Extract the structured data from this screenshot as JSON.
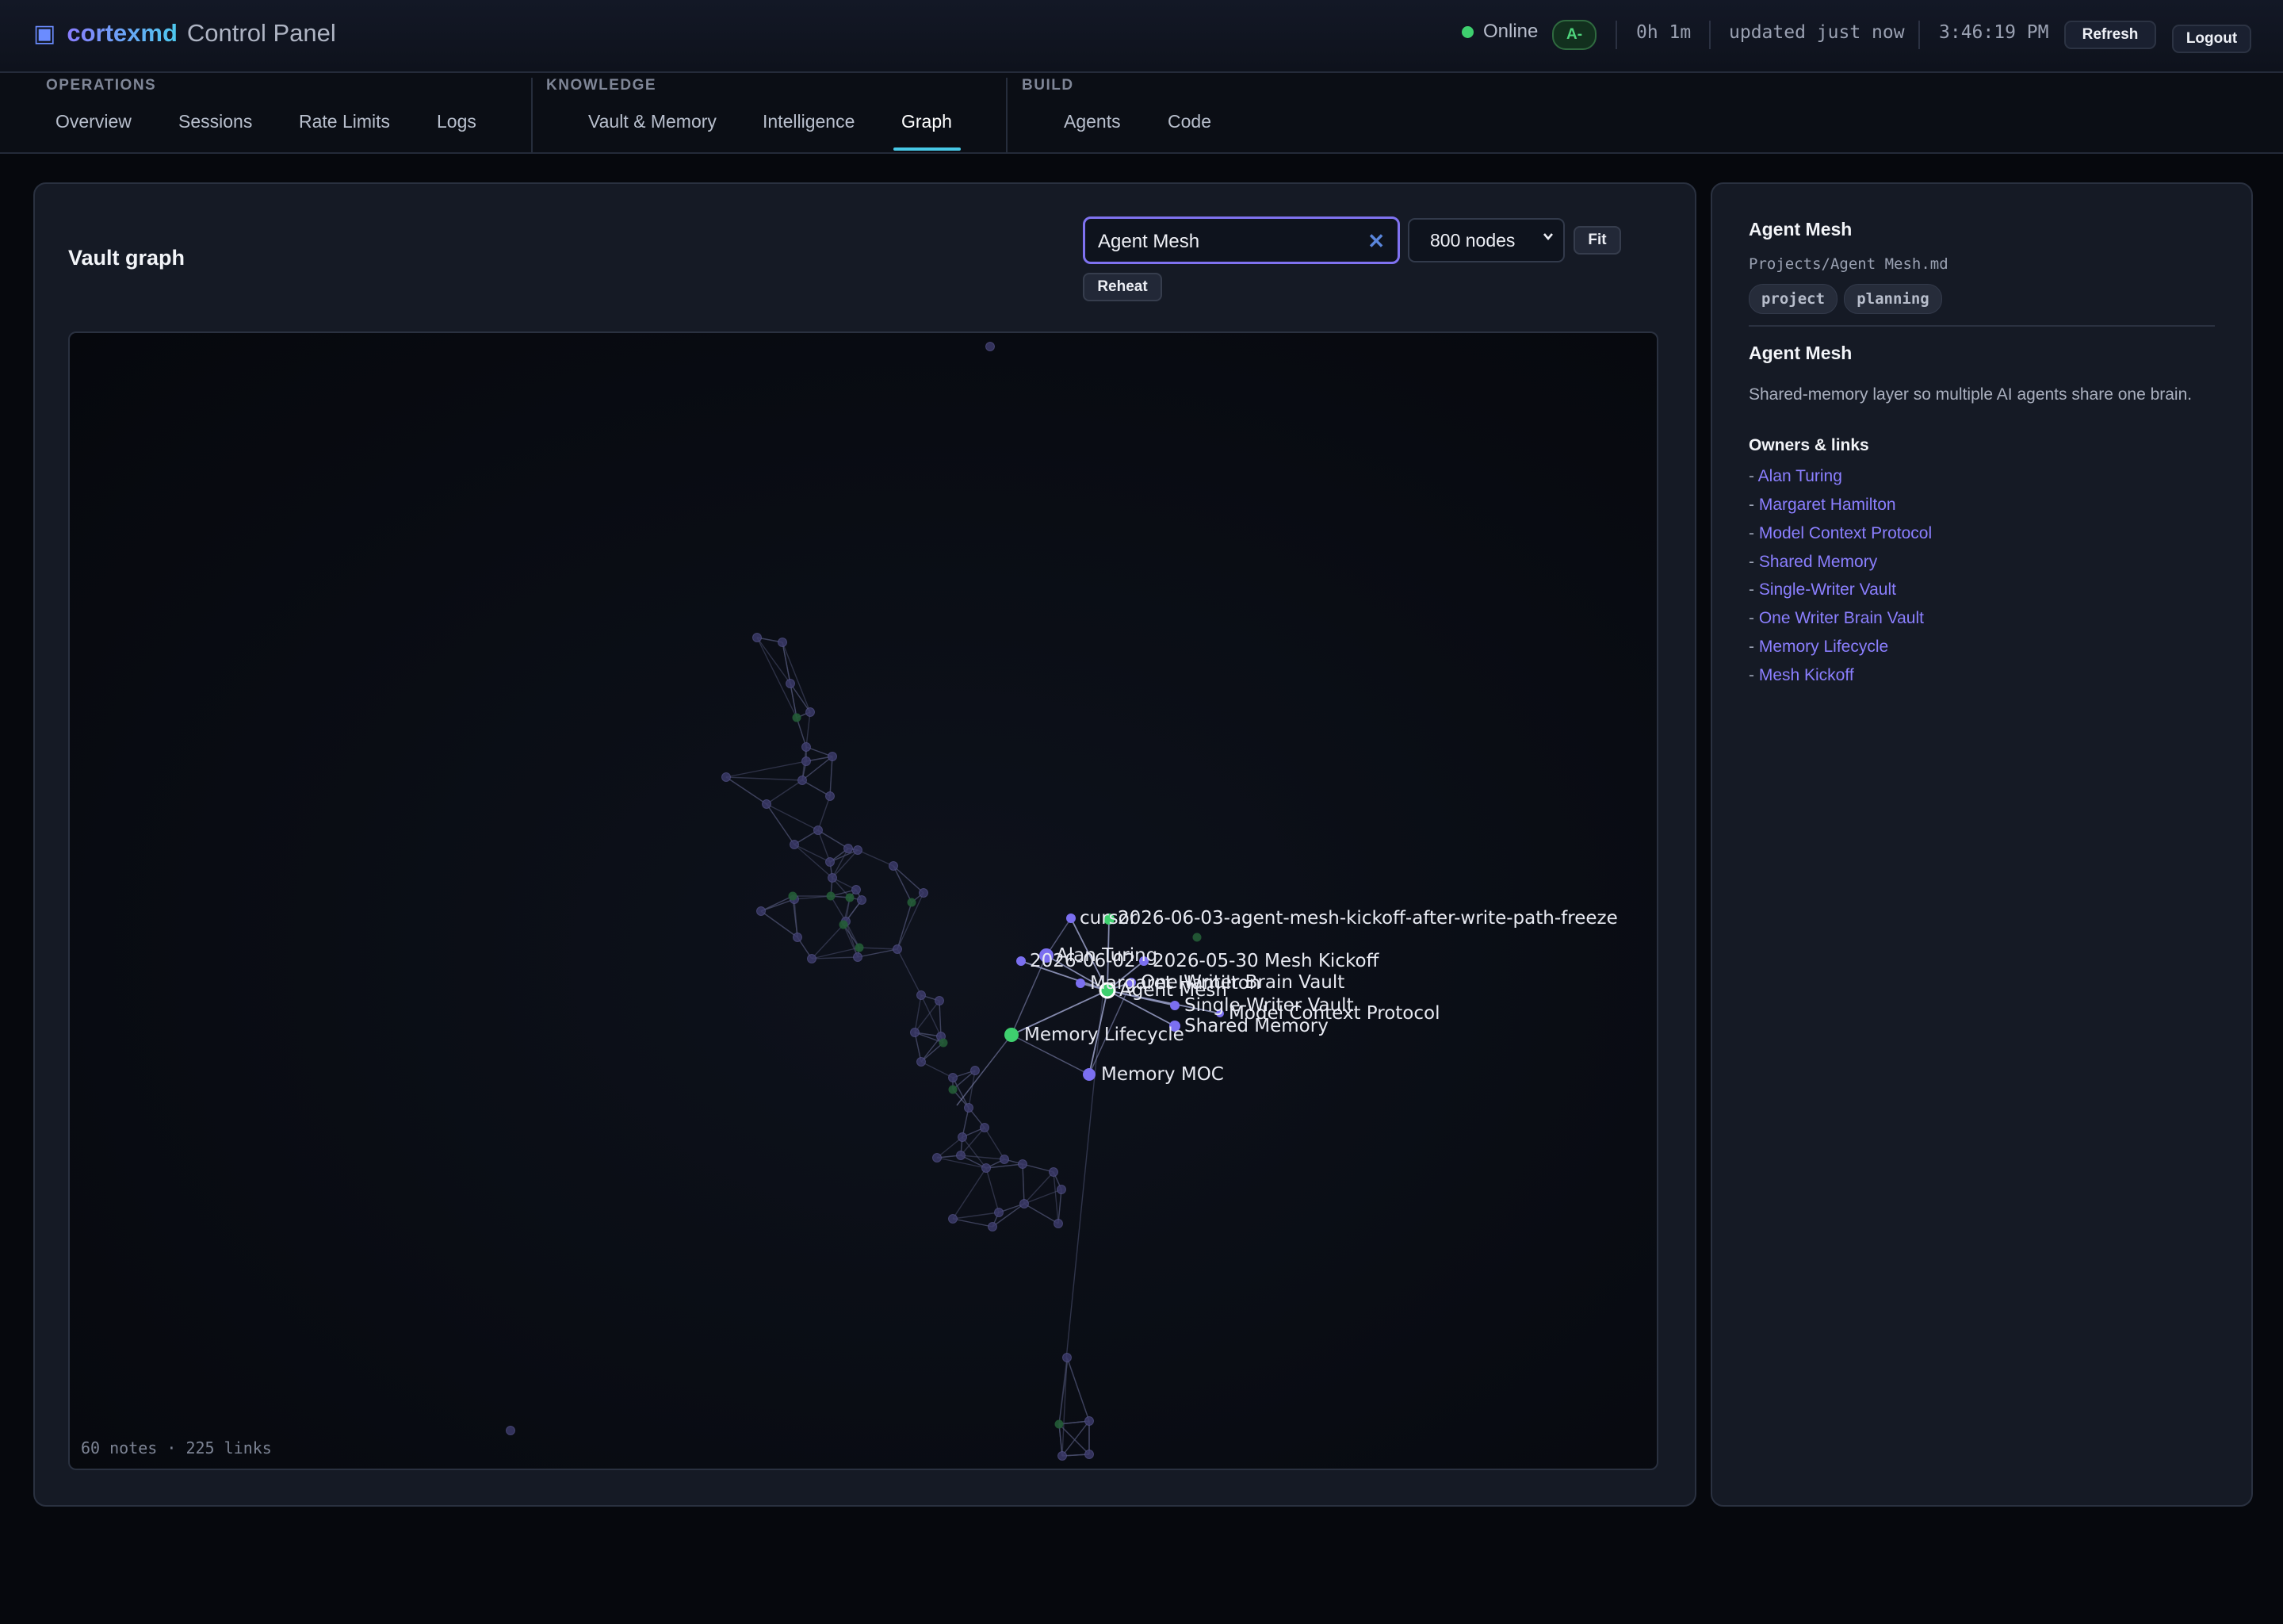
{
  "header": {
    "brand_icon": "app-square-icon",
    "brand_name": "cortexmd",
    "brand_sub": "Control Panel",
    "status": "Online",
    "grade": "A-",
    "uptime": "0h 1m",
    "updated": "updated just now",
    "time": "3:46:19 PM",
    "refresh_label": "Refresh",
    "logout_label": "Logout"
  },
  "nav": {
    "groups": [
      {
        "title": "OPERATIONS",
        "items": [
          "Overview",
          "Sessions",
          "Rate Limits",
          "Logs"
        ]
      },
      {
        "title": "KNOWLEDGE",
        "items": [
          "Vault & Memory",
          "Intelligence",
          "Graph"
        ]
      },
      {
        "title": "BUILD",
        "items": [
          "Agents",
          "Code"
        ]
      }
    ],
    "active": "Graph"
  },
  "graph": {
    "title": "Vault graph",
    "search_value": "Agent Mesh",
    "node_limit": "800 nodes",
    "fit_label": "Fit",
    "reheat_label": "Reheat",
    "footer": "60 notes · 225 links",
    "colors": {
      "note": "#7b6ff0",
      "hub": "#3ecf6e",
      "accent": "#47c8e6"
    },
    "labels": [
      "2026-06-03-agent-mesh-kickoff-after-write-path-freeze",
      "cursor",
      "Alan Turing",
      "2026-06-02",
      "2026-05-30 Mesh Kickoff",
      "Margaret Hamilton",
      "One Writer Brain Vault",
      "Agent Mesh",
      "Single-Writer Vault",
      "Model Context Protocol",
      "Shared Memory",
      "Memory Lifecycle",
      "Memory MOC"
    ]
  },
  "detail": {
    "title": "Agent Mesh",
    "path": "Projects/Agent Mesh.md",
    "tags": [
      "project",
      "planning"
    ],
    "heading": "Agent Mesh",
    "description": "Shared-memory layer so multiple AI agents share one brain.",
    "links_heading": "Owners & links",
    "links": [
      "Alan Turing",
      "Margaret Hamilton",
      "Model Context Protocol",
      "Shared Memory",
      "Single-Writer Vault",
      "One Writer Brain Vault",
      "Memory Lifecycle",
      "Mesh Kickoff"
    ]
  }
}
